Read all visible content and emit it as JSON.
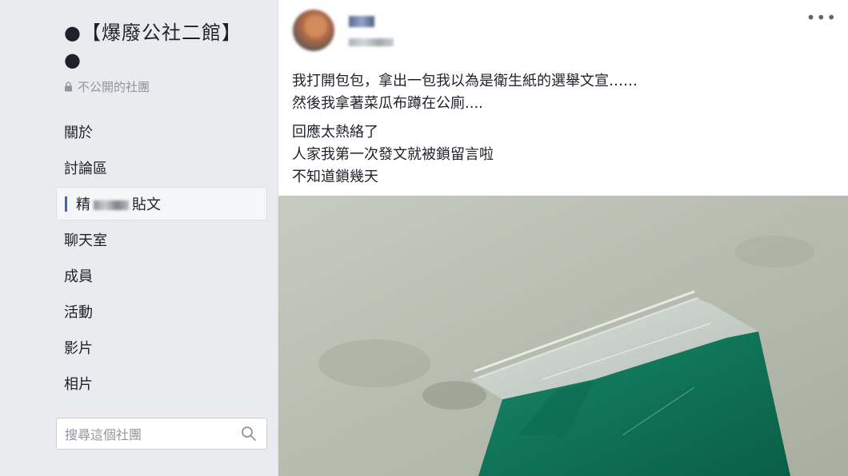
{
  "sidebar": {
    "group_title": "●【爆廢公社二館】●",
    "privacy_label": "不公開的社團",
    "nav": [
      {
        "label": "關於"
      },
      {
        "label": "討論區"
      },
      {
        "label": "貼文",
        "prefix": "精",
        "active": true
      },
      {
        "label": "聊天室"
      },
      {
        "label": "成員"
      },
      {
        "label": "活動"
      },
      {
        "label": "影片"
      },
      {
        "label": "相片"
      }
    ],
    "search_placeholder": "搜尋這個社團"
  },
  "post": {
    "author": "",
    "timestamp": "",
    "more_label": "•••",
    "paragraphs": [
      "我打開包包，拿出一包我以為是衛生紙的選舉文宣……",
      "然後我拿著菜瓜布蹲在公廁....",
      "回應太熱絡了",
      "人家我第一次發文就被鎖留言啦",
      "不知道鎖幾天"
    ]
  },
  "colors": {
    "accent": "#4267b2",
    "sidebar_bg": "#e9ebee",
    "muted_text": "#90949c"
  }
}
